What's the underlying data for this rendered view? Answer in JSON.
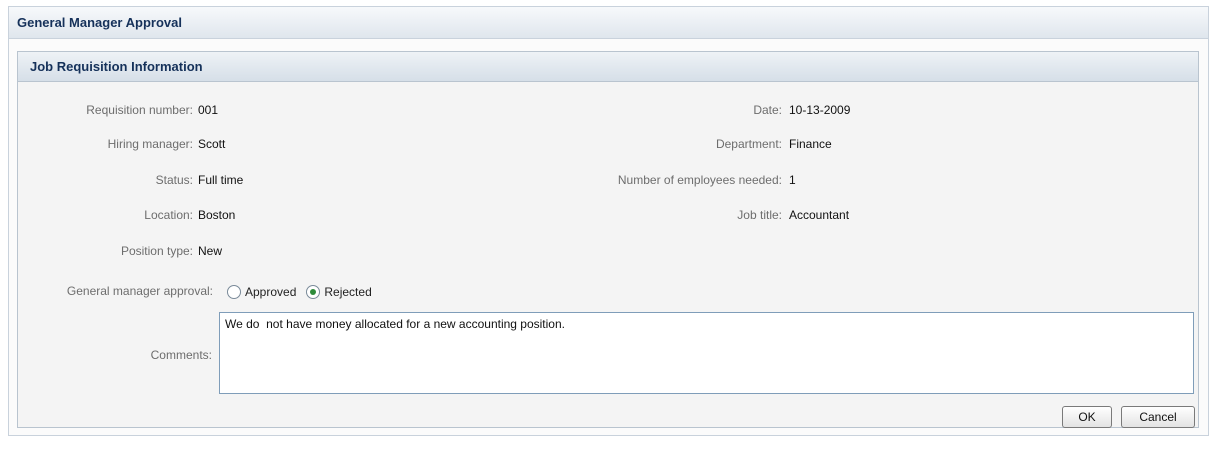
{
  "window": {
    "title": "General Manager Approval"
  },
  "section": {
    "title": "Job Requisition Information"
  },
  "fields": {
    "requisition_number": {
      "label": "Requisition number:",
      "value": "001"
    },
    "hiring_manager": {
      "label": "Hiring manager:",
      "value": "Scott"
    },
    "status": {
      "label": "Status:",
      "value": "Full time"
    },
    "location": {
      "label": "Location:",
      "value": "Boston"
    },
    "position_type": {
      "label": "Position type:",
      "value": "New"
    },
    "date": {
      "label": "Date:",
      "value": "10-13-2009"
    },
    "department": {
      "label": "Department:",
      "value": "Finance"
    },
    "employees_needed": {
      "label": "Number of employees needed:",
      "value": "1"
    },
    "job_title": {
      "label": "Job title:",
      "value": "Accountant"
    }
  },
  "approval": {
    "label": "General manager approval:",
    "options": [
      {
        "label": "Approved",
        "selected": false
      },
      {
        "label": "Rejected",
        "selected": true
      }
    ]
  },
  "comments": {
    "label": "Comments:",
    "value": "We do  not have money allocated for a new accounting position."
  },
  "buttons": {
    "ok": "OK",
    "cancel": "Cancel"
  },
  "colors": {
    "header_text": "#15315a",
    "selected_radio": "#2e8b3a"
  }
}
